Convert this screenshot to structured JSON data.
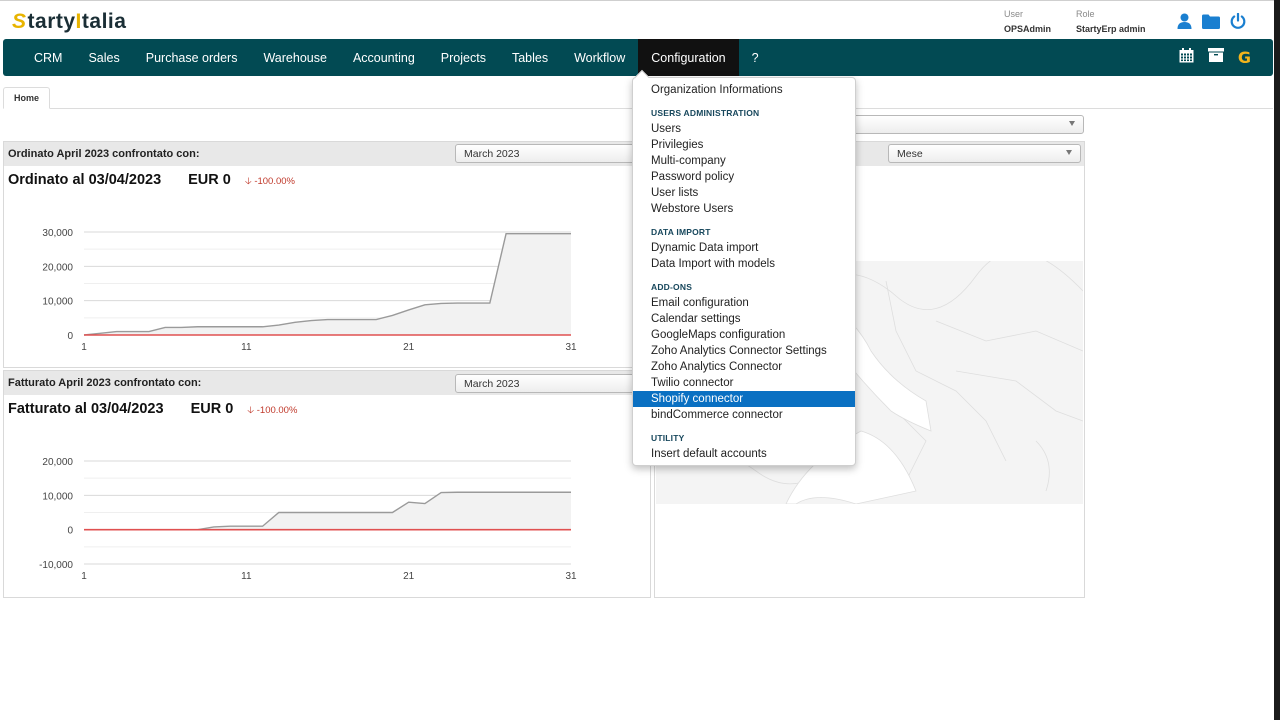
{
  "brand": {
    "logo_slash": "S",
    "logo_a": "tarty",
    "logo_bar": "I",
    "logo_b": "talia"
  },
  "user": {
    "user_label": "User",
    "user_value": "OPSAdmin",
    "role_label": "Role",
    "role_value": "StartyErp admin"
  },
  "header_icons": [
    "user-icon",
    "folder-icon",
    "power-icon"
  ],
  "navbar": {
    "items": [
      {
        "label": "CRM"
      },
      {
        "label": "Sales"
      },
      {
        "label": "Purchase orders"
      },
      {
        "label": "Warehouse"
      },
      {
        "label": "Accounting"
      },
      {
        "label": "Projects"
      },
      {
        "label": "Tables"
      },
      {
        "label": "Workflow"
      },
      {
        "label": "Configuration",
        "active": true
      },
      {
        "label": "?"
      }
    ],
    "right_icons": [
      "calendar-icon",
      "archive-icon",
      "g-icon"
    ],
    "g_label": "G",
    "active_color": "#111111",
    "bg_color": "#024a53"
  },
  "tabs": [
    {
      "label": "Home"
    }
  ],
  "panels": {
    "ordinato": {
      "header": "Ordinato April 2023 confrontato con:",
      "compare_select": "March 2023",
      "title": "Ordinato al 03/04/2023",
      "amount": "EUR 0",
      "delta": "-100.00%"
    },
    "fatturato": {
      "header": "Fatturato April 2023 confrontato con:",
      "compare_select": "March 2023",
      "title": "Fatturato al 03/04/2023",
      "amount": "EUR 0",
      "delta": "-100.00%"
    },
    "map": {
      "top_select": "",
      "period_select": "Mese"
    }
  },
  "dropdown": {
    "items": [
      {
        "type": "item",
        "label": "Organization Informations"
      },
      {
        "type": "section",
        "label": "USERS ADMINISTRATION"
      },
      {
        "type": "item",
        "label": "Users"
      },
      {
        "type": "item",
        "label": "Privilegies"
      },
      {
        "type": "item",
        "label": "Multi-company"
      },
      {
        "type": "item",
        "label": "Password policy"
      },
      {
        "type": "item",
        "label": "User lists"
      },
      {
        "type": "item",
        "label": "Webstore Users"
      },
      {
        "type": "section",
        "label": "DATA IMPORT"
      },
      {
        "type": "item",
        "label": "Dynamic Data import"
      },
      {
        "type": "item",
        "label": "Data Import with models"
      },
      {
        "type": "section",
        "label": "ADD-ONS"
      },
      {
        "type": "item",
        "label": "Email configuration"
      },
      {
        "type": "item",
        "label": "Calendar settings"
      },
      {
        "type": "item",
        "label": "GoogleMaps configuration"
      },
      {
        "type": "item",
        "label": "Zoho Analytics Connector Settings"
      },
      {
        "type": "item",
        "label": "Zoho Analytics Connector"
      },
      {
        "type": "item",
        "label": "Twilio connector"
      },
      {
        "type": "item",
        "label": "Shopify connector",
        "selected": true
      },
      {
        "type": "item",
        "label": "bindCommerce connector"
      },
      {
        "type": "section",
        "label": "UTILITY"
      },
      {
        "type": "item",
        "label": "Insert default accounts"
      }
    ],
    "selected_color": "#0a70c2"
  },
  "chart_data": [
    {
      "type": "area",
      "title": "Ordinato",
      "x": [
        1,
        2,
        3,
        4,
        5,
        6,
        7,
        8,
        9,
        10,
        11,
        12,
        13,
        14,
        15,
        16,
        17,
        18,
        19,
        20,
        21,
        22,
        23,
        24,
        25,
        26,
        27,
        28,
        29,
        30,
        31
      ],
      "xticks": [
        "1",
        "11",
        "21",
        "31"
      ],
      "yticks": [
        "0",
        "10,000",
        "20,000",
        "30,000"
      ],
      "ylim": [
        0,
        30000
      ],
      "grid": true,
      "series": [
        {
          "name": "March 2023",
          "color": "#9a9a9a",
          "fill": "#f2f2f2",
          "values": [
            0,
            500,
            1000,
            1000,
            1000,
            2200,
            2200,
            2400,
            2400,
            2400,
            2400,
            2400,
            2900,
            3700,
            4200,
            4500,
            4500,
            4500,
            4500,
            5700,
            7300,
            8800,
            9200,
            9300,
            9300,
            9300,
            29500,
            29500,
            29500,
            29500,
            29500
          ]
        },
        {
          "name": "April 2023",
          "color": "#e05050",
          "values": [
            0,
            0,
            0,
            0,
            0,
            0,
            0,
            0,
            0,
            0,
            0,
            0,
            0,
            0,
            0,
            0,
            0,
            0,
            0,
            0,
            0,
            0,
            0,
            0,
            0,
            0,
            0,
            0,
            0,
            0,
            0
          ]
        }
      ]
    },
    {
      "type": "area",
      "title": "Fatturato",
      "x": [
        1,
        2,
        3,
        4,
        5,
        6,
        7,
        8,
        9,
        10,
        11,
        12,
        13,
        14,
        15,
        16,
        17,
        18,
        19,
        20,
        21,
        22,
        23,
        24,
        25,
        26,
        27,
        28,
        29,
        30,
        31
      ],
      "xticks": [
        "1",
        "11",
        "21",
        "31"
      ],
      "yticks": [
        "-10,000",
        "0",
        "10,000",
        "20,000"
      ],
      "ylim": [
        -10000,
        20000
      ],
      "grid": true,
      "series": [
        {
          "name": "March 2023",
          "color": "#9a9a9a",
          "fill": "#f2f2f2",
          "values": [
            0,
            0,
            0,
            0,
            0,
            0,
            0,
            0,
            800,
            1000,
            1000,
            1000,
            5000,
            5000,
            5000,
            5000,
            5000,
            5000,
            5000,
            5000,
            8000,
            7600,
            10800,
            10900,
            10900,
            10900,
            10900,
            10900,
            10900,
            10900,
            10900
          ]
        },
        {
          "name": "April 2023",
          "color": "#e05050",
          "values": [
            0,
            0,
            0,
            0,
            0,
            0,
            0,
            0,
            0,
            0,
            0,
            0,
            0,
            0,
            0,
            0,
            0,
            0,
            0,
            0,
            0,
            0,
            0,
            0,
            0,
            0,
            0,
            0,
            0,
            0,
            0
          ]
        }
      ]
    }
  ]
}
